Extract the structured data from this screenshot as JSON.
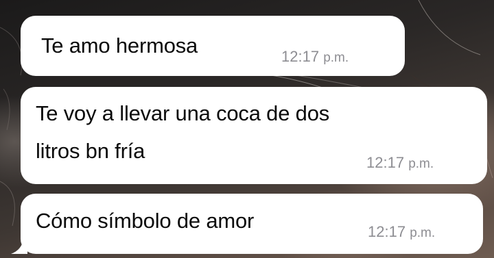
{
  "chat": {
    "messages": [
      {
        "text": "Te amo hermosa",
        "time": "12:17",
        "period": "p.m."
      },
      {
        "text_line_1": "Te voy a llevar una coca de dos",
        "text_line_2": "litros bn fría",
        "time": "12:17",
        "period": "p.m."
      },
      {
        "text": "Cómo símbolo de amor",
        "time": "12:17",
        "period": "p.m."
      }
    ]
  },
  "colors": {
    "bubble": "#ffffff",
    "text": "#0b0b0b",
    "timestamp": "#8d8d92"
  }
}
